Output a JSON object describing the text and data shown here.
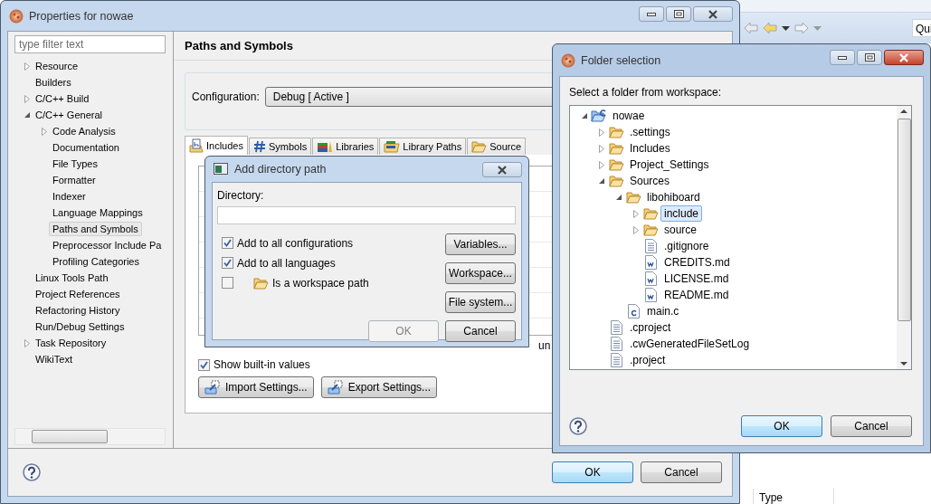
{
  "ide": {
    "quick_access": "Qui",
    "table_header": "Type"
  },
  "properties_window": {
    "title": "Properties for nowae",
    "active": false,
    "filter": {
      "placeholder": "type filter text"
    },
    "tree": [
      {
        "label": "Resource",
        "expanded": false,
        "selected": false
      },
      {
        "label": "Builders",
        "selected": false
      },
      {
        "label": "C/C++ Build",
        "expanded": false,
        "selected": false
      },
      {
        "label": "C/C++ General",
        "expanded": true,
        "selected": false,
        "children": [
          {
            "label": "Code Analysis",
            "expanded": false,
            "selected": false
          },
          {
            "label": "Documentation",
            "selected": false
          },
          {
            "label": "File Types",
            "selected": false
          },
          {
            "label": "Formatter",
            "selected": false
          },
          {
            "label": "Indexer",
            "selected": false
          },
          {
            "label": "Language Mappings",
            "selected": false
          },
          {
            "label": "Paths and Symbols",
            "selected": true
          },
          {
            "label": "Preprocessor Include Pa",
            "selected": false
          },
          {
            "label": "Profiling Categories",
            "selected": false
          }
        ]
      },
      {
        "label": "Linux Tools Path",
        "selected": false
      },
      {
        "label": "Project References",
        "selected": false
      },
      {
        "label": "Refactoring History",
        "selected": false
      },
      {
        "label": "Run/Debug Settings",
        "selected": false
      },
      {
        "label": "Task Repository",
        "expanded": false,
        "selected": false
      },
      {
        "label": "WikiText",
        "selected": false
      }
    ],
    "page_title": "Paths and Symbols",
    "configuration": {
      "label": "Configuration:",
      "value": "Debug  [ Active ]"
    },
    "tabs": [
      {
        "label": "Includes",
        "kind": "includes",
        "selected": true
      },
      {
        "label": "Symbols",
        "kind": "symbols",
        "selected": false
      },
      {
        "label": "Libraries",
        "kind": "libraries",
        "selected": false
      },
      {
        "label": "Library Paths",
        "kind": "library_paths",
        "selected": false
      },
      {
        "label": "Source",
        "kind": "source",
        "selected": false
      }
    ],
    "hint_fragments": [
      "un"
    ],
    "show_builtin": {
      "label": "Show built-in values",
      "checked": true
    },
    "settings_buttons": [
      {
        "label": "Import Settings...",
        "kind": "import"
      },
      {
        "label": "Export Settings...",
        "kind": "export"
      }
    ],
    "buttons": [
      {
        "label": "OK",
        "default": true
      },
      {
        "label": "Cancel",
        "default": false
      }
    ]
  },
  "add_directory_dialog": {
    "title": "Add directory path",
    "active": false,
    "field_label": "Directory:",
    "checks": [
      {
        "label": "Add to all configurations",
        "checked": true,
        "kind": "plain"
      },
      {
        "label": "Add to all languages",
        "checked": true,
        "kind": "plain"
      },
      {
        "label": "Is a workspace path",
        "checked": false,
        "kind": "folder"
      }
    ],
    "side_buttons": [
      "Variables...",
      "Workspace...",
      "File system..."
    ],
    "buttons": [
      {
        "label": "OK",
        "disabled": true
      },
      {
        "label": "Cancel",
        "disabled": false
      }
    ]
  },
  "folder_dialog": {
    "title": "Folder selection",
    "active": true,
    "prompt": "Select a folder from workspace:",
    "tree": [
      {
        "label": "nowae",
        "kind": "project",
        "expanded": true,
        "selected": false,
        "children": [
          {
            "label": ".settings",
            "kind": "folder",
            "expanded": false,
            "selected": false
          },
          {
            "label": "Includes",
            "kind": "folder",
            "expanded": false,
            "selected": false
          },
          {
            "label": "Project_Settings",
            "kind": "folder",
            "expanded": false,
            "selected": false
          },
          {
            "label": "Sources",
            "kind": "folder",
            "expanded": true,
            "selected": false,
            "children": [
              {
                "label": "libohiboard",
                "kind": "folder",
                "expanded": true,
                "selected": false,
                "children": [
                  {
                    "label": "include",
                    "kind": "folder",
                    "expanded": false,
                    "selected": true
                  },
                  {
                    "label": "source",
                    "kind": "folder",
                    "expanded": false,
                    "selected": false
                  },
                  {
                    "label": ".gitignore",
                    "kind": "text_file",
                    "selected": false
                  },
                  {
                    "label": "CREDITS.md",
                    "kind": "doc_file",
                    "selected": false
                  },
                  {
                    "label": "LICENSE.md",
                    "kind": "doc_file",
                    "selected": false
                  },
                  {
                    "label": "README.md",
                    "kind": "doc_file",
                    "selected": false
                  }
                ]
              },
              {
                "label": "main.c",
                "kind": "c_file",
                "selected": false
              }
            ]
          },
          {
            "label": ".cproject",
            "kind": "text_file",
            "selected": false
          },
          {
            "label": ".cwGeneratedFileSetLog",
            "kind": "text_file",
            "selected": false
          },
          {
            "label": ".project",
            "kind": "text_file",
            "selected": false
          }
        ]
      }
    ],
    "buttons": [
      {
        "label": "OK",
        "default": true
      },
      {
        "label": "Cancel",
        "default": false
      }
    ]
  }
}
